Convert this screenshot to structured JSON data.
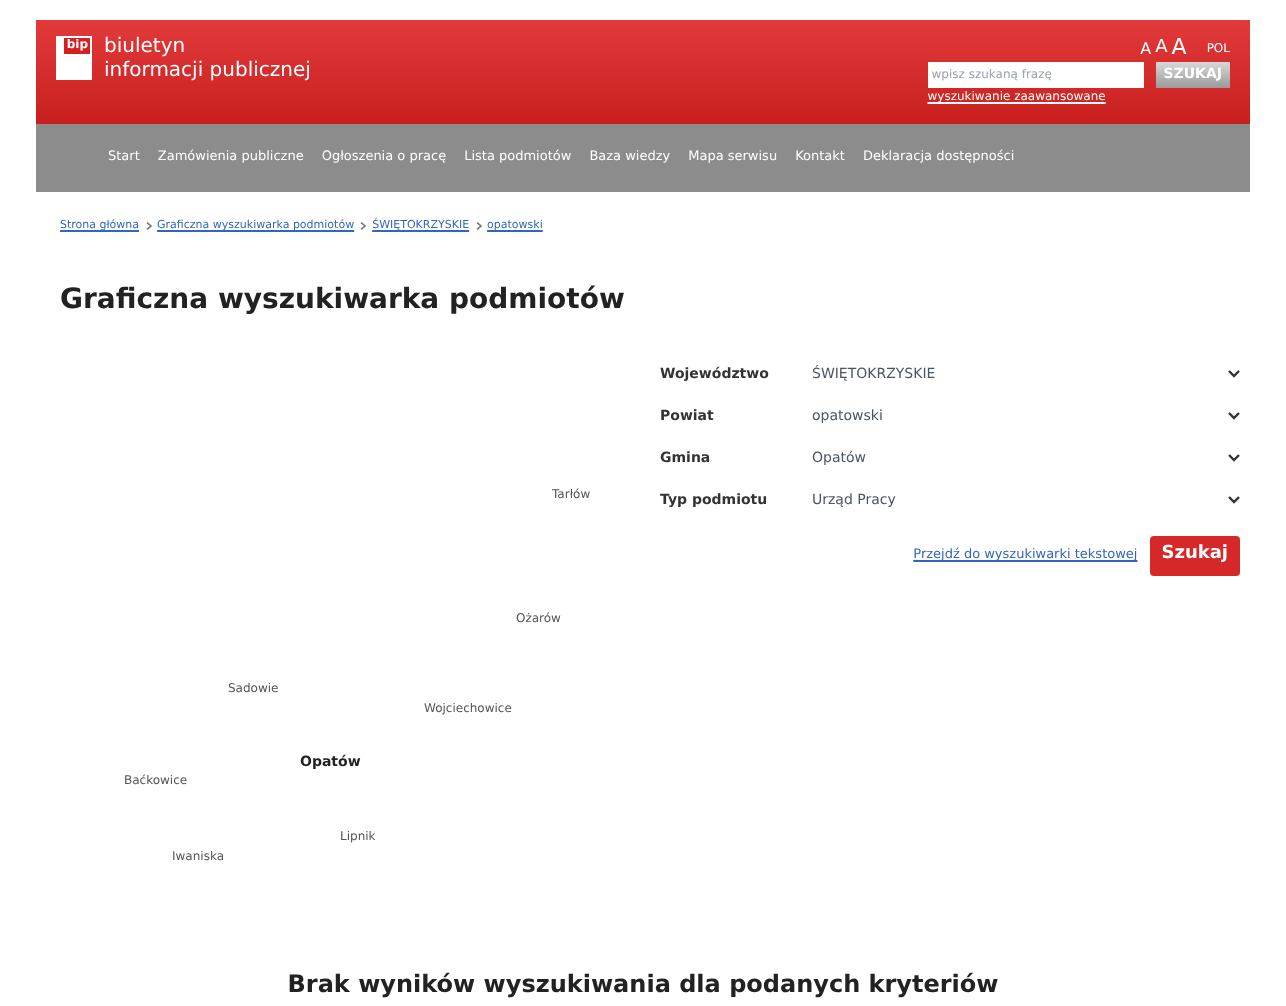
{
  "header": {
    "logo_badge": "bip",
    "logo_text_1": "biuletyn",
    "logo_text_2": "informacji publicznej",
    "font_sizes": [
      "A",
      "A",
      "A"
    ],
    "language": "POL",
    "search": {
      "placeholder": "wpisz szukaną frazę"
    },
    "search_button": "SZUKAJ",
    "advanced_link": "wyszukiwanie zaawansowane"
  },
  "nav": [
    "Start",
    "Zamówienia publiczne",
    "Ogłoszenia o pracę",
    "Lista podmiotów",
    "Baza wiedzy",
    "Mapa serwisu",
    "Kontakt",
    "Deklaracja dostępności"
  ],
  "breadcrumb": [
    "Strona główna",
    "Graficzna wyszukiwarka podmiotów",
    "ŚWIĘTOKRZYSKIE",
    "opatowski"
  ],
  "title": "Graficzna wyszukiwarka podmiotów",
  "form": {
    "fields": [
      {
        "label": "Województwo",
        "value": "ŚWIĘTOKRZYSKIE"
      },
      {
        "label": "Powiat",
        "value": "opatowski"
      },
      {
        "label": "Gmina",
        "value": "Opatów"
      },
      {
        "label": "Typ podmiotu",
        "value": "Urząd Pracy"
      }
    ],
    "text_search_link": "Przejdź do wyszukiwarki tekstowej",
    "search_button": "Szukaj"
  },
  "map": {
    "places": [
      {
        "name": "Tarłów",
        "selected": false
      },
      {
        "name": "Ożarów",
        "selected": false
      },
      {
        "name": "Sadowie",
        "selected": false
      },
      {
        "name": "Wojciechowice",
        "selected": false
      },
      {
        "name": "Opatów",
        "selected": true
      },
      {
        "name": "Baćkowice",
        "selected": false
      },
      {
        "name": "Lipnik",
        "selected": false
      },
      {
        "name": "Iwaniska",
        "selected": false
      }
    ]
  },
  "message": "Brak wyników wyszukiwania dla podanych kryteriów"
}
